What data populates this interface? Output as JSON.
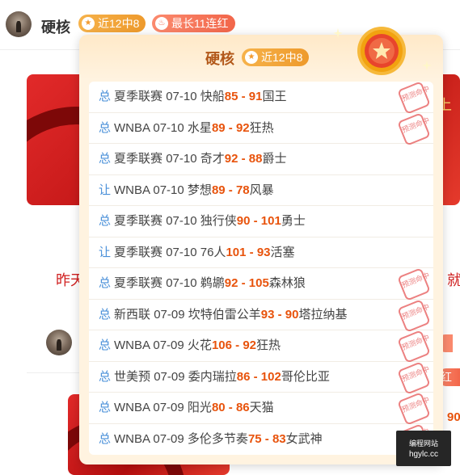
{
  "header": {
    "name": "硬核",
    "win_tag": "近12中8",
    "streak_tag": "最长11连红",
    "win_icon": "star-icon",
    "streak_icon": "flame-icon"
  },
  "background": {
    "text_left": "昨天",
    "text_right": "就",
    "pill_text": "红",
    "number_fragment": "90",
    "banner_fragment": "上"
  },
  "popup": {
    "title": "硬核",
    "tag": "近12中8",
    "stamp_text": "预测命中",
    "rows": [
      {
        "type": "总",
        "league": "夏季联赛",
        "date": "07-10",
        "home": "快船",
        "home_score": "85",
        "sep": " - ",
        "away_score": "91",
        "away": "国王",
        "hit": true
      },
      {
        "type": "总",
        "league": "WNBA",
        "date": "07-10",
        "home": "水星",
        "home_score": "89",
        "sep": " - ",
        "away_score": "92",
        "away": "狂热",
        "hit": true
      },
      {
        "type": "总",
        "league": "夏季联赛",
        "date": "07-10",
        "home": "奇才",
        "home_score": "92",
        "sep": " - ",
        "away_score": "88",
        "away": "爵士",
        "hit": false
      },
      {
        "type": "让",
        "league": "WNBA",
        "date": "07-10",
        "home": "梦想",
        "home_score": "89",
        "sep": " - ",
        "away_score": "78",
        "away": "风暴",
        "hit": false
      },
      {
        "type": "总",
        "league": "夏季联赛",
        "date": "07-10",
        "home": "独行侠",
        "home_score": "90",
        "sep": " - ",
        "away_score": "101",
        "away": "勇士",
        "hit": false
      },
      {
        "type": "让",
        "league": "夏季联赛",
        "date": "07-10",
        "home": "76人",
        "home_score": "101",
        "sep": " - ",
        "away_score": "93",
        "away": "活塞",
        "hit": false
      },
      {
        "type": "总",
        "league": "夏季联赛",
        "date": "07-10",
        "home": "鹈鹕",
        "home_score": "92",
        "sep": " - ",
        "away_score": "105",
        "away": "森林狼",
        "hit": true
      },
      {
        "type": "总",
        "league": "新西联",
        "date": "07-09",
        "home": "坎特伯雷公羊",
        "home_score": "93",
        "sep": " - ",
        "away_score": "90",
        "away": "塔拉纳基",
        "hit": true
      },
      {
        "type": "总",
        "league": "WNBA",
        "date": "07-09",
        "home": "火花",
        "home_score": "106",
        "sep": " - ",
        "away_score": "92",
        "away": "狂热",
        "hit": true
      },
      {
        "type": "总",
        "league": "世美预",
        "date": "07-09",
        "home": "委内瑞拉",
        "home_score": "86",
        "sep": " - ",
        "away_score": "102",
        "away": "哥伦比亚",
        "hit": true
      },
      {
        "type": "总",
        "league": "WNBA",
        "date": "07-09",
        "home": "阳光",
        "home_score": "80",
        "sep": " - ",
        "away_score": "86",
        "away": "天猫",
        "hit": true
      },
      {
        "type": "总",
        "league": "WNBA",
        "date": "07-09",
        "home": "多伦多节奏",
        "home_score": "75",
        "sep": " - ",
        "away_score": "83",
        "away": "女武神",
        "hit": true
      }
    ]
  },
  "watermark": {
    "line1": "编程网站",
    "line2": "hgylc.cc"
  },
  "colors": {
    "score": "#e8530c",
    "type": "#4a90d9",
    "title": "#b2581a",
    "stamp": "#e65757"
  }
}
